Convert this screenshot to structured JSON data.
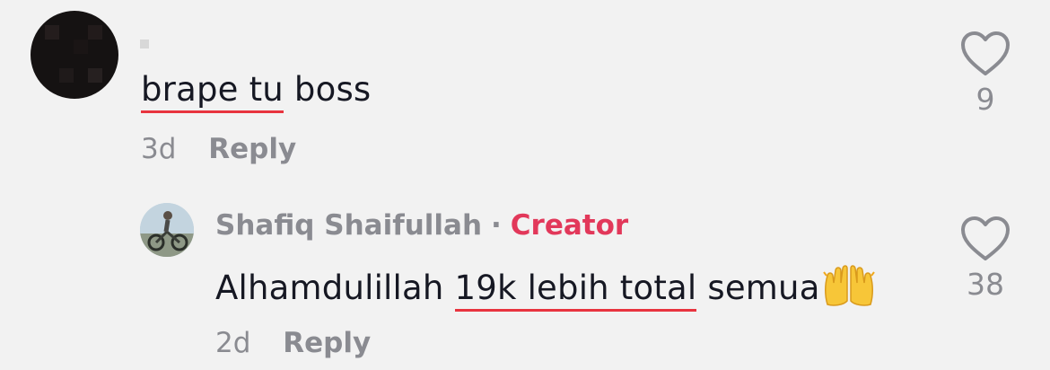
{
  "comments": [
    {
      "text_underlined": "brape tu",
      "text_rest": " boss",
      "age": "3d",
      "reply_label": "Reply",
      "likes": "9"
    }
  ],
  "reply": {
    "author": "Shafiq Shaifullah",
    "separator": "·",
    "badge": "Creator",
    "text_before": "Alhamdulillah ",
    "text_underlined": "19k lebih total",
    "text_after": " semua",
    "emoji": "raising-hands-icon",
    "age": "2d",
    "reply_label": "Reply",
    "likes": "38"
  },
  "colors": {
    "background": "#f2f2f2",
    "text": "#161823",
    "muted": "#8a8b91",
    "creator": "#e2385a",
    "underline": "#e8343f"
  }
}
